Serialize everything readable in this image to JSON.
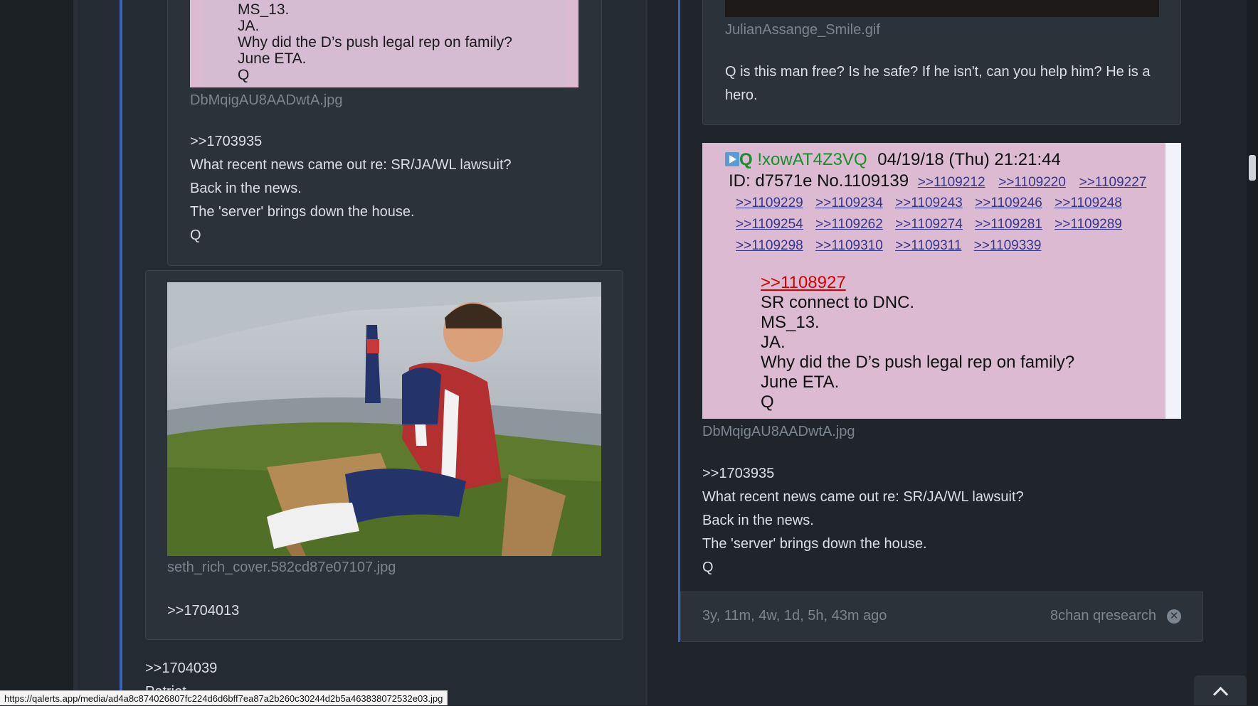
{
  "left": {
    "top_image": {
      "lines": [
        "MS_13.",
        "JA.",
        "Why did the D’s push legal rep on family?",
        "June ETA.",
        "Q"
      ],
      "filename": "DbMqigAU8AADwtA.jpg"
    },
    "post1": {
      "lines": [
        ">>1703935",
        "What recent news came out re: SR/JA/WL lawsuit?",
        "Back in the news.",
        "The 'server' brings down the house.",
        "Q"
      ]
    },
    "post2": {
      "filename": "seth_rich_cover.582cd87e07107.jpg",
      "ref": ">>1704013"
    },
    "post3": {
      "ref": ">>1704039",
      "partial": "Patriot"
    }
  },
  "right": {
    "top_post": {
      "filename": "JulianAssange_Smile.gif",
      "text": "Q is this man free? Is he safe?  If he isn't, can you help him?  He is a hero."
    },
    "q_post": {
      "marker": "Q",
      "tripcode": "!xowAT4Z3VQ",
      "datetime": "04/19/18 (Thu) 21:21:44",
      "id_line": "ID: d7571e No.1109139",
      "replies": [
        ">>1109212",
        ">>1109220",
        ">>1109227",
        ">>1109229",
        ">>1109234",
        ">>1109243",
        ">>1109246",
        ">>1109248",
        ">>1109254",
        ">>1109262",
        ">>1109274",
        ">>1109281",
        ">>1109289",
        ">>1109298",
        ">>1109310",
        ">>1109311",
        ">>1109339"
      ],
      "quote_link": ">>1108927",
      "lines": [
        "SR connect to DNC.",
        "MS_13.",
        "JA.",
        "Why did the D’s push legal rep on family?",
        "June ETA.",
        "Q"
      ],
      "filename": "DbMqigAU8AADwtA.jpg"
    },
    "post_body": {
      "lines": [
        ">>1703935",
        "What recent news came out re: SR/JA/WL lawsuit?",
        "Back in the news.",
        "The 'server' brings down the house.",
        "Q"
      ]
    },
    "footer": {
      "age": "3y, 11m, 4w, 1d, 5h, 43m ago",
      "source": "8chan qresearch"
    }
  },
  "status_url": "https://qalerts.app/media/ad4a8c874026807fc224d6d6bff7ea87a2b260c30244d2b5a463838072532e03.jpg",
  "icons": {
    "close": "circle-x-icon",
    "scroll_top": "chevron-up-icon",
    "play": "play-icon"
  }
}
